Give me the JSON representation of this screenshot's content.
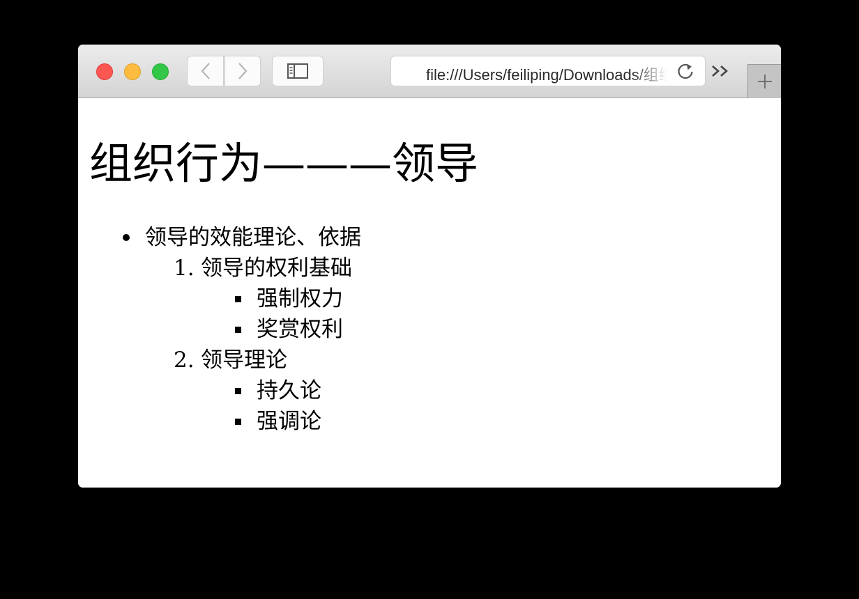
{
  "browser": {
    "address_url": "file:///Users/feiliping/Downloads/组织行为.html",
    "icons": {
      "close": "red-traffic-light",
      "minimize": "yellow-traffic-light",
      "maximize": "green-traffic-light",
      "back": "chevron-left-icon",
      "forward": "chevron-right-icon",
      "sidebar": "sidebar-icon",
      "reload": "reload-icon",
      "overflow": "double-chevron-right-icon",
      "new_tab": "plus-icon"
    }
  },
  "page": {
    "title": "组织行为———领导",
    "outline": {
      "bullet_item": "领导的效能理论、依据",
      "sections": [
        {
          "number": "1.",
          "label": "领导的权利基础",
          "items": [
            "强制权力",
            "奖赏权利"
          ]
        },
        {
          "number": "2.",
          "label": "领导理论",
          "items": [
            "持久论",
            "强调论"
          ]
        }
      ]
    }
  },
  "colors": {
    "close": "#fc5753",
    "minimize": "#fdbc40",
    "maximize": "#33c748",
    "toolbar_top": "#ececec",
    "toolbar_bottom": "#d4d4d4",
    "desktop": "#000000"
  }
}
